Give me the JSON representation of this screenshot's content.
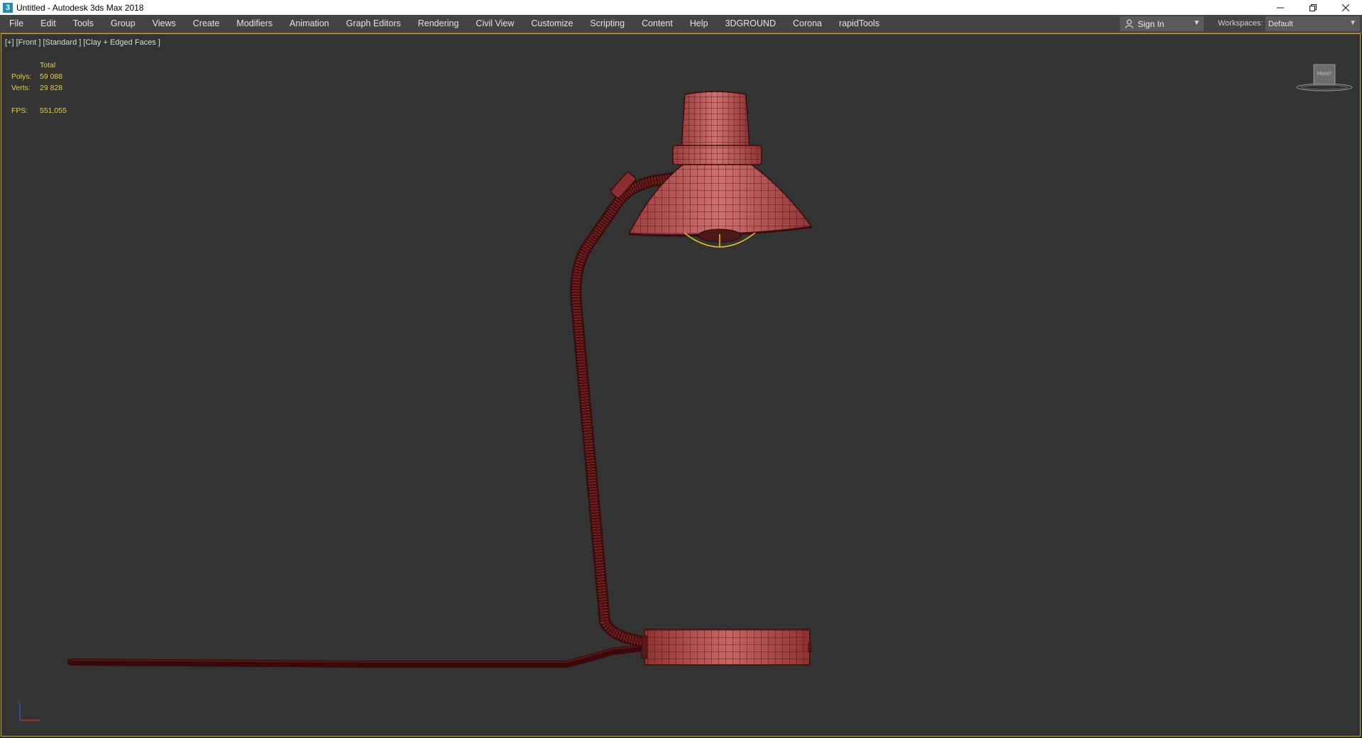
{
  "window": {
    "title": "Untitled - Autodesk 3ds Max 2018",
    "app_icon": "3"
  },
  "menu": {
    "items": [
      "File",
      "Edit",
      "Tools",
      "Group",
      "Views",
      "Create",
      "Modifiers",
      "Animation",
      "Graph Editors",
      "Rendering",
      "Civil View",
      "Customize",
      "Scripting",
      "Content",
      "Help",
      "3DGROUND",
      "Corona",
      "rapidTools"
    ]
  },
  "account": {
    "sign_in_label": "Sign In"
  },
  "workspaces": {
    "label": "Workspaces:",
    "value": "Default"
  },
  "viewport": {
    "label": "[+] [Front ] [Standard ] [Clay + Edged Faces ]",
    "stats": {
      "header": "Total",
      "polys_label": "Polys:",
      "polys_value": "59 088",
      "verts_label": "Verts:",
      "verts_value": "29 828",
      "fps_label": "FPS:",
      "fps_value": "551,055"
    },
    "viewcube_face": "FRONT"
  },
  "colors": {
    "viewport_bg": "#333333",
    "viewport_border": "#c9a925",
    "stats_text": "#e9d23a",
    "model_clay": "#b5494a",
    "model_edges": "#3d0d0d"
  }
}
